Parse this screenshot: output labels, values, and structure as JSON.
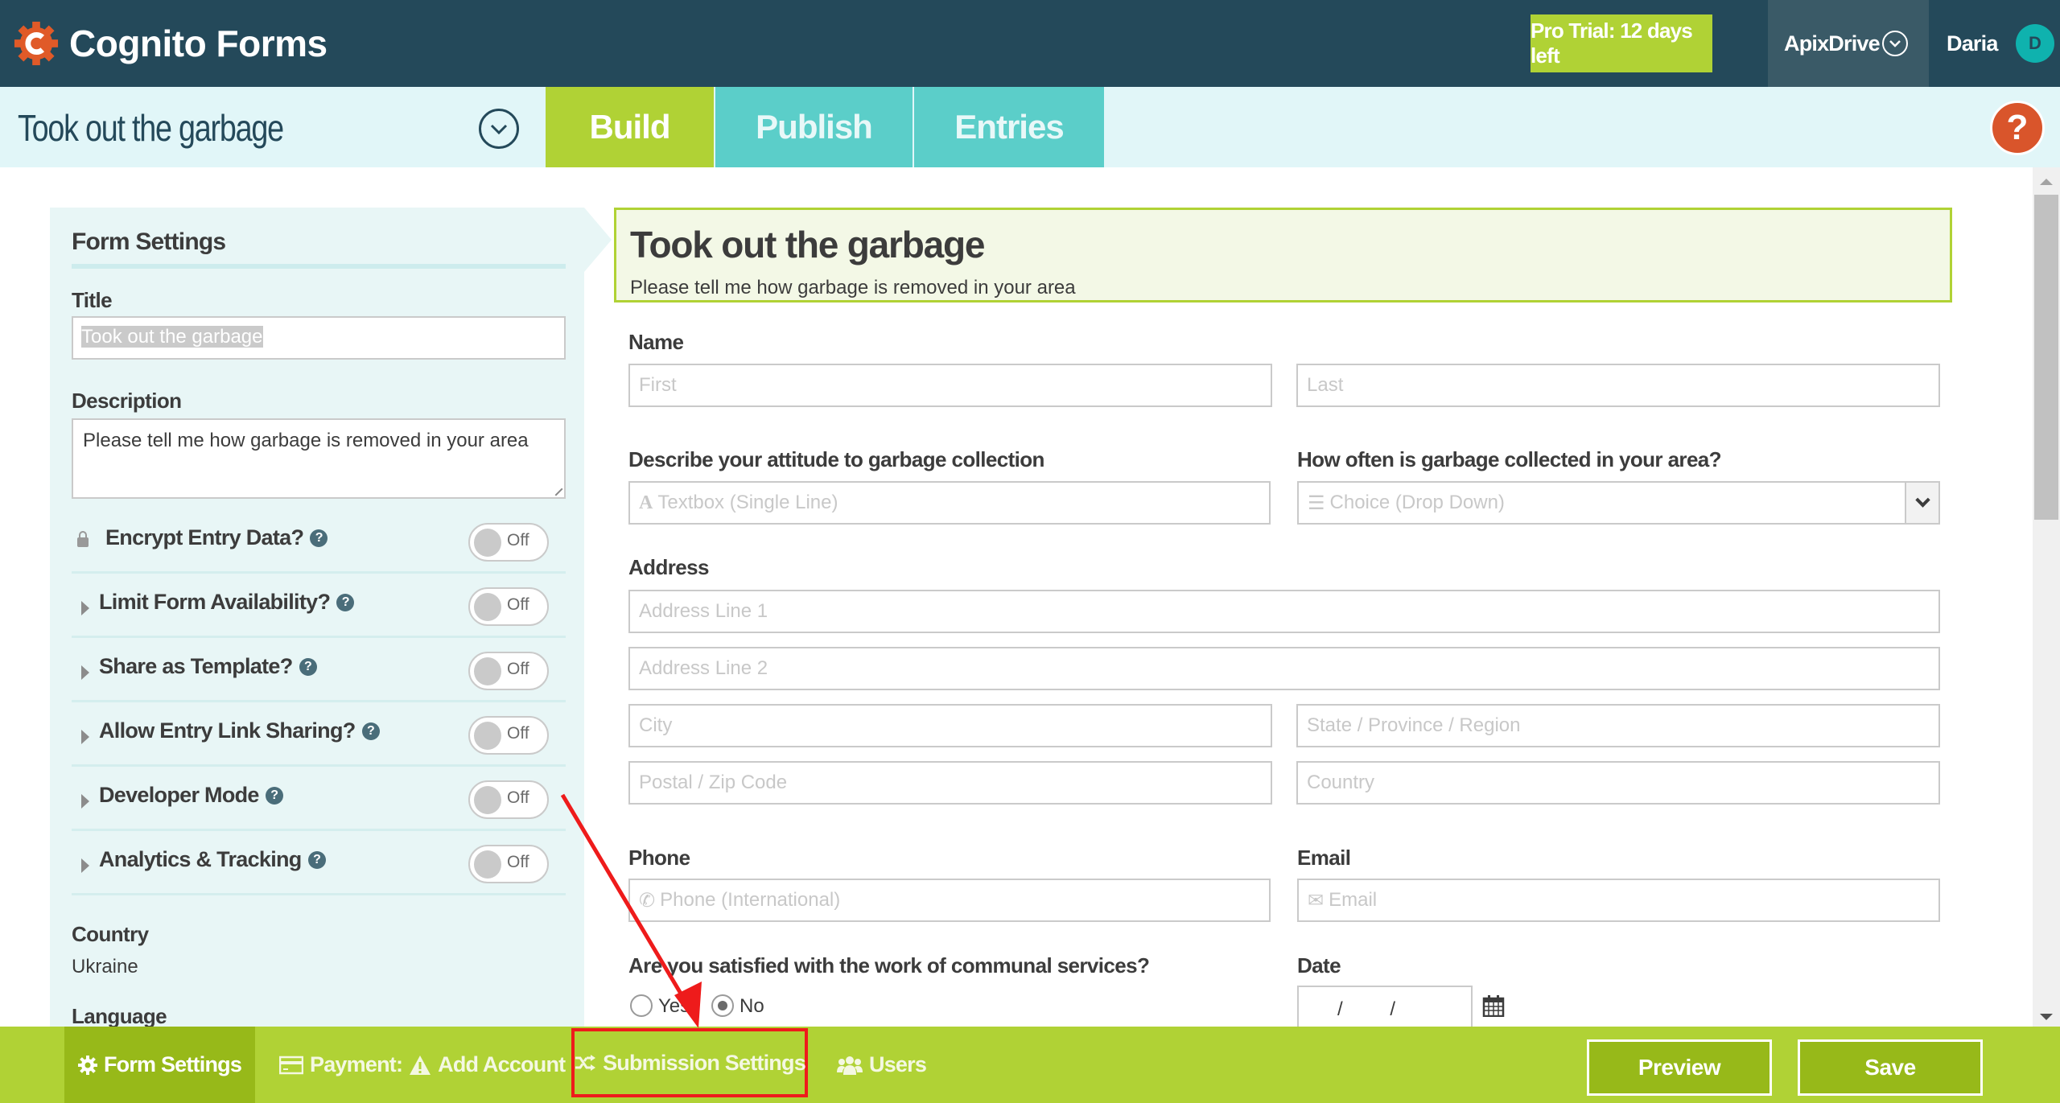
{
  "header": {
    "brand": "Cognito Forms",
    "trial_badge": "Pro Trial: 12 days left",
    "organization": "ApixDrive",
    "user_name": "Daria",
    "user_initial": "D"
  },
  "tabbar": {
    "form_title": "Took out the garbage",
    "tabs": [
      {
        "label": "Build",
        "active": true
      },
      {
        "label": "Publish",
        "active": false
      },
      {
        "label": "Entries",
        "active": false
      }
    ],
    "help_label": "?"
  },
  "form_settings": {
    "heading": "Form Settings",
    "title_label": "Title",
    "title_value": "Took out the garbage",
    "description_label": "Description",
    "description_value": "Please tell me how garbage is removed in your area",
    "toggles": [
      {
        "label": "Encrypt Entry Data?",
        "state": "Off",
        "icon": "lock-icon"
      },
      {
        "label": "Limit Form Availability?",
        "state": "Off",
        "icon": "caret-right-icon"
      },
      {
        "label": "Share as Template?",
        "state": "Off",
        "icon": "caret-right-icon"
      },
      {
        "label": "Allow Entry Link Sharing?",
        "state": "Off",
        "icon": "caret-right-icon"
      },
      {
        "label": "Developer Mode",
        "state": "Off",
        "icon": "caret-right-icon"
      },
      {
        "label": "Analytics & Tracking",
        "state": "Off",
        "icon": "caret-right-icon"
      }
    ],
    "country_label": "Country",
    "country_value": "Ukraine",
    "language_label": "Language"
  },
  "form": {
    "title": "Took out the garbage",
    "description": "Please tell me how garbage is removed in your area",
    "name": {
      "label": "Name",
      "first_placeholder": "First",
      "last_placeholder": "Last"
    },
    "attitude": {
      "label": "Describe your attitude to garbage collection",
      "placeholder": "Textbox (Single Line)"
    },
    "frequency": {
      "label": "How often is garbage collected in your area?",
      "placeholder": "Choice (Drop Down)"
    },
    "address": {
      "label": "Address",
      "line1": "Address Line 1",
      "line2": "Address Line 2",
      "city": "City",
      "state": "State / Province / Region",
      "postal": "Postal / Zip Code",
      "country": "Country"
    },
    "phone": {
      "label": "Phone",
      "placeholder": "Phone (International)"
    },
    "email": {
      "label": "Email",
      "placeholder": "Email"
    },
    "satisfied": {
      "label": "Are you satisfied with the work of communal services?",
      "options": [
        {
          "label": "Yes",
          "checked": false
        },
        {
          "label": "No",
          "checked": true
        }
      ]
    },
    "date": {
      "label": "Date",
      "value": "/ /"
    }
  },
  "bottombar": {
    "tabs": [
      {
        "label": "Form Settings",
        "icon": "gear-icon",
        "active": true
      },
      {
        "label": "Payment:",
        "warning_label": "Add Account",
        "icon": "credit-card-icon"
      },
      {
        "label": "Submission Settings",
        "icon": "shuffle-icon",
        "highlighted": true
      },
      {
        "label": "Users",
        "icon": "users-icon"
      }
    ],
    "preview_label": "Preview",
    "save_label": "Save"
  },
  "colors": {
    "header_bg": "#24495a",
    "accent_green": "#b0d235",
    "active_green": "#97b919",
    "teal_tab": "#5bcec9",
    "help_orange": "#d9552b",
    "annotation_red": "#ee1b1b"
  }
}
